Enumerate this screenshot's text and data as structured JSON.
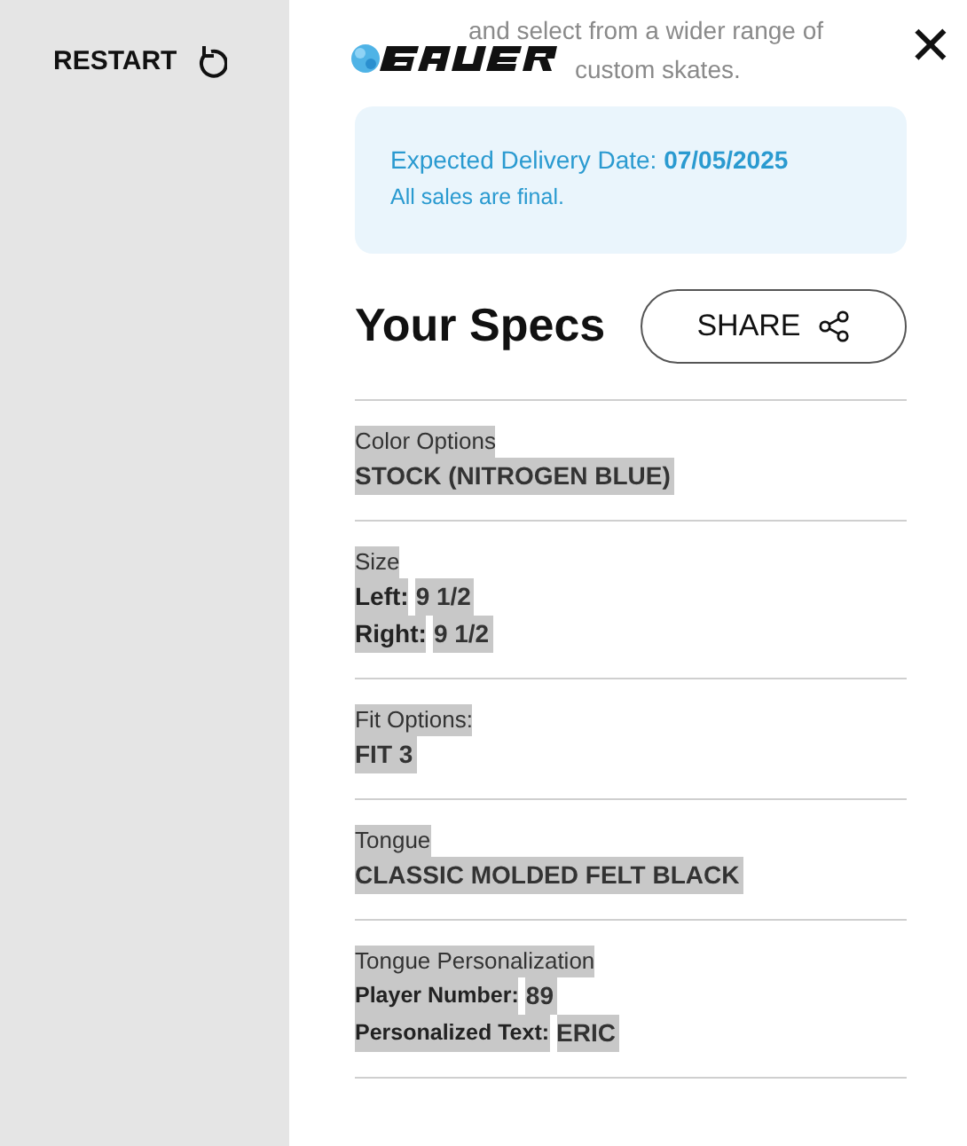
{
  "sidebar": {
    "restart_label": "RESTART"
  },
  "intro_lines": [
    "and select from a wider range of",
    "custom skates."
  ],
  "close_label": "✕",
  "delivery": {
    "label": "Expected Delivery Date: ",
    "date": "07/05/2025",
    "note": "All sales are final."
  },
  "heading": "Your Specs",
  "share_button": "SHARE",
  "specs": [
    {
      "label": "Color Options",
      "highlighted": true,
      "values": [
        {
          "value": "STOCK (NITROGEN BLUE)"
        }
      ]
    },
    {
      "label": "Size",
      "highlighted": true,
      "values": [
        {
          "key": "Left:",
          "value": "9 1/2"
        },
        {
          "key": "Right:",
          "value": "9 1/2"
        }
      ]
    },
    {
      "label": "Fit Options:",
      "highlighted": true,
      "values": [
        {
          "value": "FIT 3"
        }
      ]
    },
    {
      "label": "Tongue",
      "highlighted": true,
      "values": [
        {
          "value": "CLASSIC MOLDED FELT BLACK"
        }
      ]
    },
    {
      "label": "Tongue Personalization",
      "highlighted": true,
      "small_keys": true,
      "values": [
        {
          "key": "Player Number:",
          "value": "89"
        },
        {
          "key": "Personalized Text:",
          "value": "ERIC"
        }
      ]
    }
  ]
}
